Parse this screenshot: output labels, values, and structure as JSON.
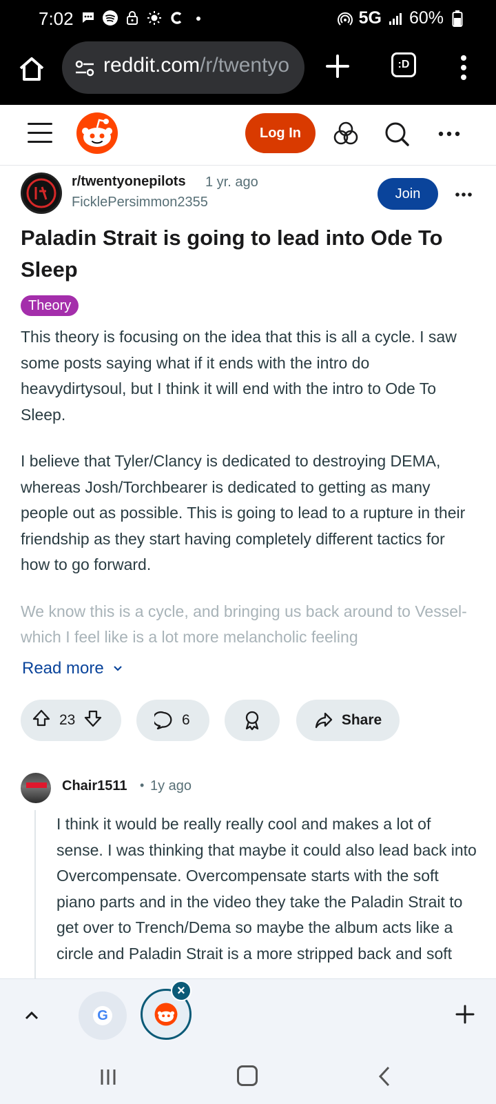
{
  "status_bar": {
    "time": "7:02",
    "network": "5G",
    "battery": "60%"
  },
  "browser": {
    "url_domain": "reddit.com",
    "url_path": "/r/twentyo",
    "tabs_label": ":D"
  },
  "header": {
    "login_label": "Log In"
  },
  "post": {
    "subreddit": "r/twentyonepilots",
    "age": "1 yr. ago",
    "author": "FicklePersimmon2355",
    "join_label": "Join",
    "title": "Paladin Strait is going to lead into Ode To Sleep",
    "flair": "Theory",
    "paragraphs": [
      "This theory is focusing on the idea that this is all a cycle. I saw some posts saying what if it ends with the intro do heavydirtysoul, but I think it will end with the intro to Ode To Sleep.",
      "I believe that Tyler/Clancy is dedicated to destroying DEMA, whereas Josh/Torchbearer is dedicated to getting as many people out as possible. This is going to lead to a rupture in their friendship as they start having completely different tactics for how to go forward.",
      "We know this is a cycle, and bringing us back around to Vessel- which I feel like is a lot more melancholic feeling"
    ],
    "read_more": "Read more",
    "upvotes": "23",
    "comments": "6",
    "share_label": "Share"
  },
  "comment": {
    "author": "Chair1511",
    "separator": "•",
    "age": "1y ago",
    "body": "I think it would be really really cool and makes a lot of sense. I was thinking that maybe it could also lead back into Overcompensate. Overcompensate starts with the soft piano parts and in the video they take the Paladin Strait to get over to Trench/Dema so maybe the album acts like a circle and Paladin Strait is a more stripped back and soft"
  },
  "tab_strip": {
    "google_tab_letter": "G"
  },
  "colors": {
    "reddit_orange": "#d93a00",
    "join_blue": "#0a449b",
    "flair_purple": "#a42eab",
    "link_blue": "#0a449b"
  }
}
